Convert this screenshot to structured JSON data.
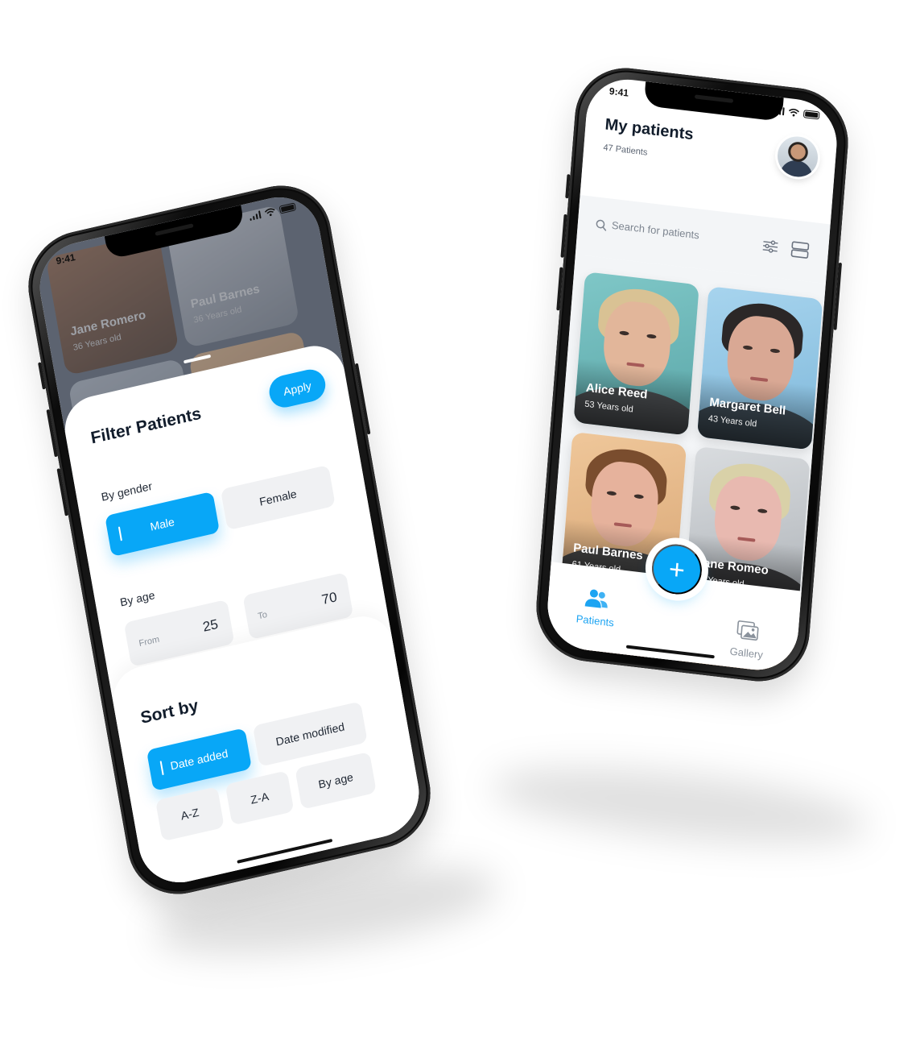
{
  "left_phone": {
    "status_time": "9:41",
    "background_cards": [
      {
        "name": "Jane Romero",
        "age": "36 Years old"
      },
      {
        "name": "Paul Barnes",
        "age": "36 Years old"
      }
    ],
    "filter": {
      "title": "Filter Patients",
      "apply_label": "Apply",
      "gender_label": "By gender",
      "gender_options": [
        "Male",
        "Female"
      ],
      "gender_selected": "Male",
      "age_label": "By age",
      "age_from_placeholder": "From",
      "age_from_value": "25",
      "age_to_placeholder": "To",
      "age_to_value": "70"
    },
    "sort": {
      "title": "Sort by",
      "options": [
        "Date added",
        "Date modified",
        "A-Z",
        "Z-A",
        "By age"
      ],
      "selected": "Date added"
    }
  },
  "right_phone": {
    "status_time": "9:41",
    "title": "My patients",
    "subtitle": "47 Patients",
    "search_placeholder": "Search for patients",
    "patients": [
      {
        "name": "Alice Reed",
        "age": "53 Years old"
      },
      {
        "name": "Margaret Bell",
        "age": "43 Years old"
      },
      {
        "name": "Paul Barnes",
        "age": "61 Years old"
      },
      {
        "name": "Jane Romeo",
        "age": "58 Years old"
      }
    ],
    "fab_label": "+",
    "tabs": [
      {
        "label": "Patients",
        "icon": "users-icon",
        "active": true
      },
      {
        "label": "Gallery",
        "icon": "gallery-icon",
        "active": false
      }
    ]
  },
  "colors": {
    "accent": "#08a7f7",
    "text_dark": "#111c2b",
    "chip_bg": "#f0f1f3",
    "tab_inactive": "#8a929c"
  }
}
